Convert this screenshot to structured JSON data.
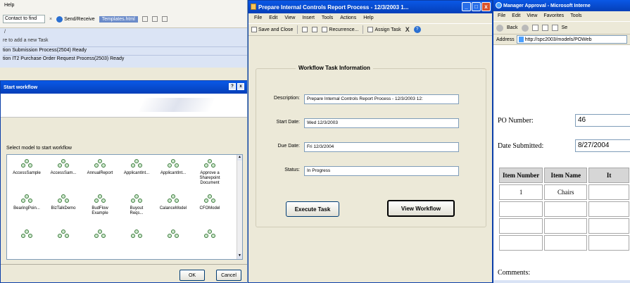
{
  "left": {
    "menu_help": "Help",
    "address_text": "Contact to find",
    "close_x": "×",
    "send_receive": "Send/Receive",
    "templates": "Templates.html",
    "band_slash": "/",
    "band_hint": "re to add a new Task",
    "task1": "tion Submission Process(2504) Ready",
    "task2": "tion IT2 Purchase Order Request Process(2503) Ready"
  },
  "dialog": {
    "title": "Start workflow",
    "select_label": "Select model to start workflow",
    "models": [
      "AccessSample",
      "AccessSam...",
      "AnnualReport",
      "ApplicantInt...",
      "ApplicantInt...",
      "Approve a\nSharepoint\nDocument",
      "BearingPoin...",
      "BizTalkDemo",
      "BudFlow\nExample",
      "Buyout\nReqs...",
      "CalanceModel",
      "CFOModel",
      "",
      "",
      "",
      "",
      "",
      ""
    ],
    "ok": "OK",
    "cancel": "Cancel"
  },
  "mid": {
    "title": "Prepare Internal Controls Report   Process - 12/3/2003 1...",
    "menu": [
      "File",
      "Edit",
      "View",
      "Insert",
      "Tools",
      "Actions",
      "Help"
    ],
    "toolbar": {
      "save_close": "Save and Close",
      "recurrence": "Recurrence...",
      "assign_task": "Assign Task",
      "delete": "X"
    },
    "group_title": "Workflow Task Information",
    "fields": {
      "description_label": "Description:",
      "description_value": "Prepare Internal Controls Report   Process - 12/3/2003 12:",
      "start_label": "Start Date:",
      "start_value": "Wed 12/3/2003",
      "due_label": "Due Date:",
      "due_value": "Fri 12/3/2004",
      "status_label": "Status:",
      "status_value": "In Progress"
    },
    "execute_task": "Execute Task",
    "view_workflow": "View Workflow"
  },
  "right": {
    "title": "Manager Approval - Microsoft Interne",
    "menu": [
      "File",
      "Edit",
      "View",
      "Favorites",
      "Tools"
    ],
    "back": "Back",
    "search": "Se",
    "address_label": "Address",
    "url": "http://spc2003/models/POWeb",
    "po_label": "PO Number:",
    "po_value": "46",
    "date_label": "Date Submitted:",
    "date_value": "8/27/2004",
    "table_headers": [
      "Item Number",
      "Item Name",
      "It"
    ],
    "table_rows": [
      [
        "1",
        "Chairs",
        ""
      ],
      [
        "",
        "",
        ""
      ],
      [
        "",
        "",
        ""
      ],
      [
        "",
        "",
        ""
      ]
    ],
    "comments_label": "Comments:"
  }
}
